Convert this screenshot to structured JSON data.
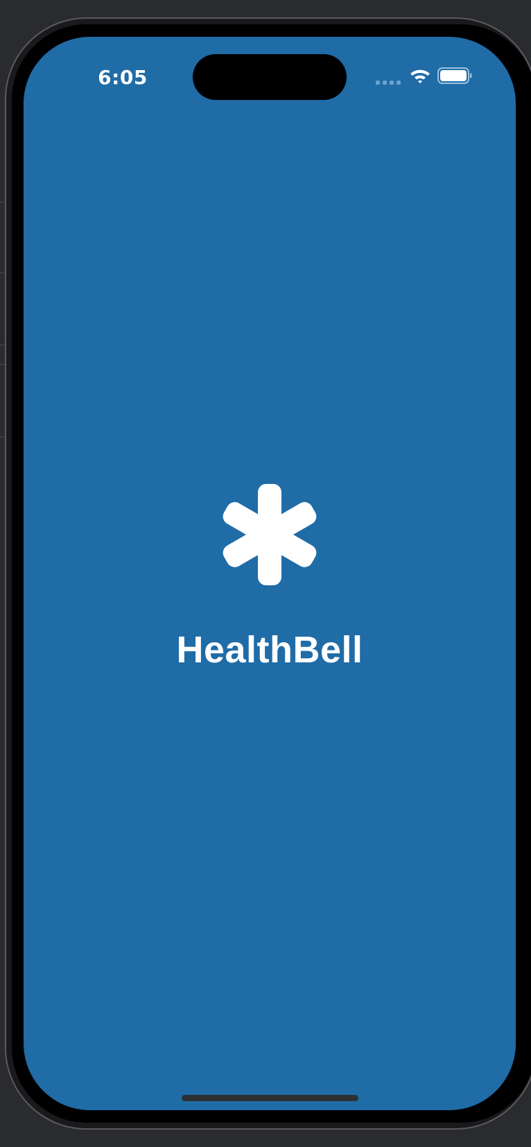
{
  "status_bar": {
    "time": "6:05",
    "icons": [
      "cellular-signal-icon",
      "wifi-icon",
      "battery-icon"
    ]
  },
  "splash": {
    "logo_icon": "asterisk-icon",
    "app_name": "HealthBell"
  },
  "colors": {
    "screen_background": "#1f6ca7",
    "foreground": "#ffffff",
    "device_frame": "#1a1a1c"
  }
}
